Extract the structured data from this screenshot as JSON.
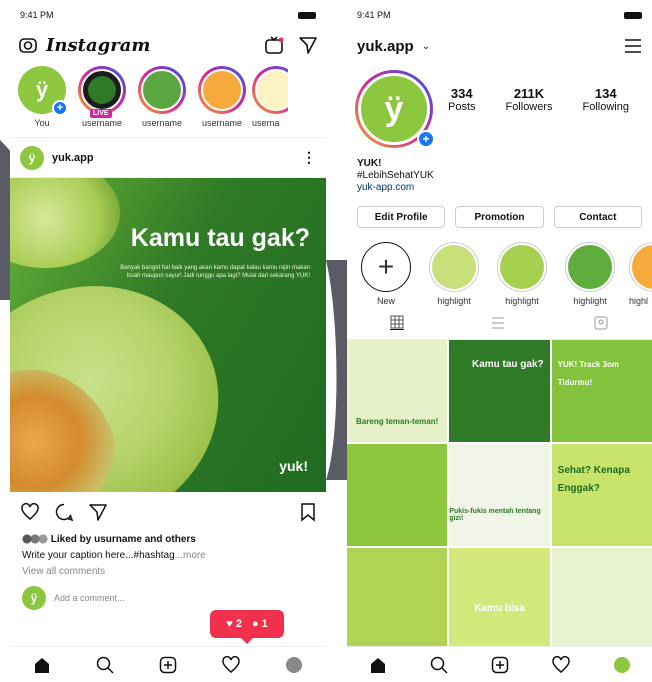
{
  "left_phone": {
    "status": {
      "time": "9:41 PM"
    },
    "header": {
      "app_name": "Instagram"
    },
    "stories": [
      {
        "label": "You"
      },
      {
        "label": "username",
        "live": "LIVE"
      },
      {
        "label": "username"
      },
      {
        "label": "username"
      },
      {
        "label": "userna"
      }
    ],
    "post": {
      "username": "yuk.app",
      "title": "Kamu tau gak?",
      "body": "Banyak banget hal baik yang akan kamu dapat kalau kamu rajin makan buah maupun sayur! Jadi tunggu apa lagi? Mulai dari sekarang YUK!",
      "brand": "yuk!",
      "liked_prefix": "Liked by",
      "liked_user": "usurname",
      "liked_suffix": "and others",
      "caption": "Write your caption here...#hashtag",
      "more": "...more",
      "view_comments": "View all comments",
      "add_comment": "Add a comment..."
    },
    "notification": {
      "likes": "2",
      "comments": "1"
    }
  },
  "right_phone": {
    "status": {
      "time": "9:41 PM"
    },
    "header": {
      "username": "yuk.app"
    },
    "stats": [
      {
        "value": "334",
        "label": "Posts"
      },
      {
        "value": "211K",
        "label": "Followers"
      },
      {
        "value": "134",
        "label": "Following"
      }
    ],
    "bio": {
      "name": "YUK!",
      "tagline": "#LebihSehatYUK",
      "link": "yuk-app.com"
    },
    "buttons": {
      "edit": "Edit Profile",
      "promotion": "Promotion",
      "contact": "Contact"
    },
    "highlights": [
      {
        "label": "New"
      },
      {
        "label": "highlight"
      },
      {
        "label": "highlight"
      },
      {
        "label": "highlight"
      },
      {
        "label": "highl"
      }
    ],
    "grid_texts": {
      "g1": "Bareng teman-teman!",
      "g2": "Kamu tau gak?",
      "g3": "YUK! Track 3om Tidurmu!",
      "g5": "Pukis-fukis mentah tentang gizi!",
      "g6": "Sehat? Kenapa Enggak?",
      "g8": "Kamu bisa"
    }
  },
  "colors": {
    "brand_green": "#8dc63f",
    "notif_red": "#f0304c",
    "ig_blue": "#1877f2"
  }
}
